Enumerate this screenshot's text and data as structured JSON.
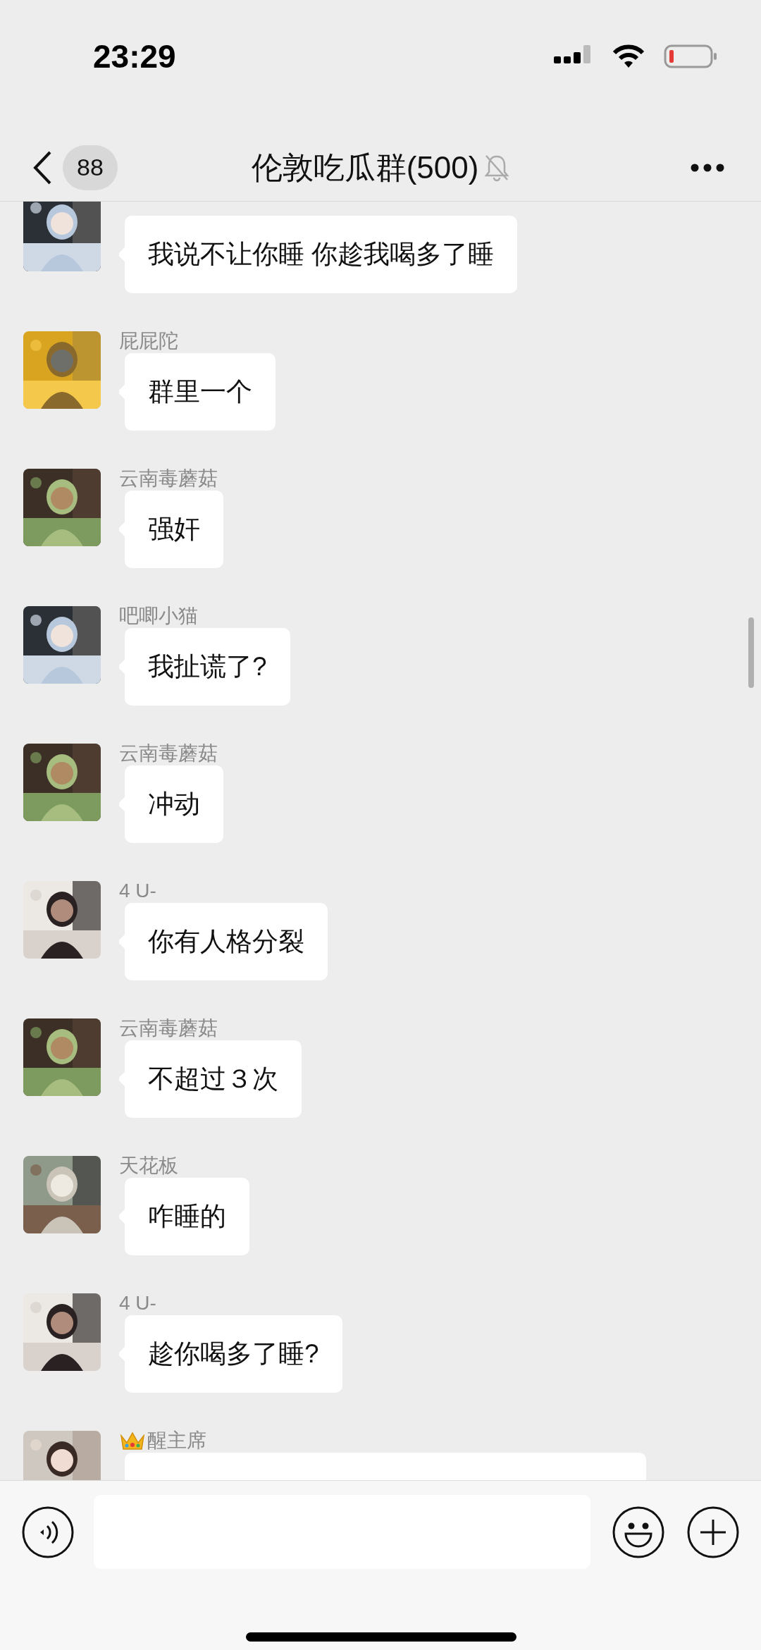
{
  "status_bar": {
    "time": "23:29"
  },
  "header": {
    "back_count": "88",
    "title": "伦敦吃瓜群(500)",
    "muted": true
  },
  "messages": [
    {
      "crown": false,
      "text": "我说不让你睡 你趁我喝多了睡"
    },
    {
      "sender": "屁屁陀",
      "crown": false,
      "text": "群里一个"
    },
    {
      "sender": "云南毒蘑菇",
      "crown": false,
      "text": "强奸"
    },
    {
      "sender": "吧唧小猫",
      "crown": false,
      "text": "我扯谎了?"
    },
    {
      "sender": "云南毒蘑菇",
      "crown": false,
      "text": "冲动"
    },
    {
      "sender": "4 U-",
      "crown": false,
      "text": "你有人格分裂"
    },
    {
      "sender": "云南毒蘑菇",
      "crown": false,
      "text": "不超过３次"
    },
    {
      "sender": "天花板",
      "crown": false,
      "text": "咋睡的"
    },
    {
      "sender": "4 U-",
      "crown": false,
      "text": "趁你喝多了睡?"
    },
    {
      "sender": "醒主席",
      "crown": true
    }
  ]
}
